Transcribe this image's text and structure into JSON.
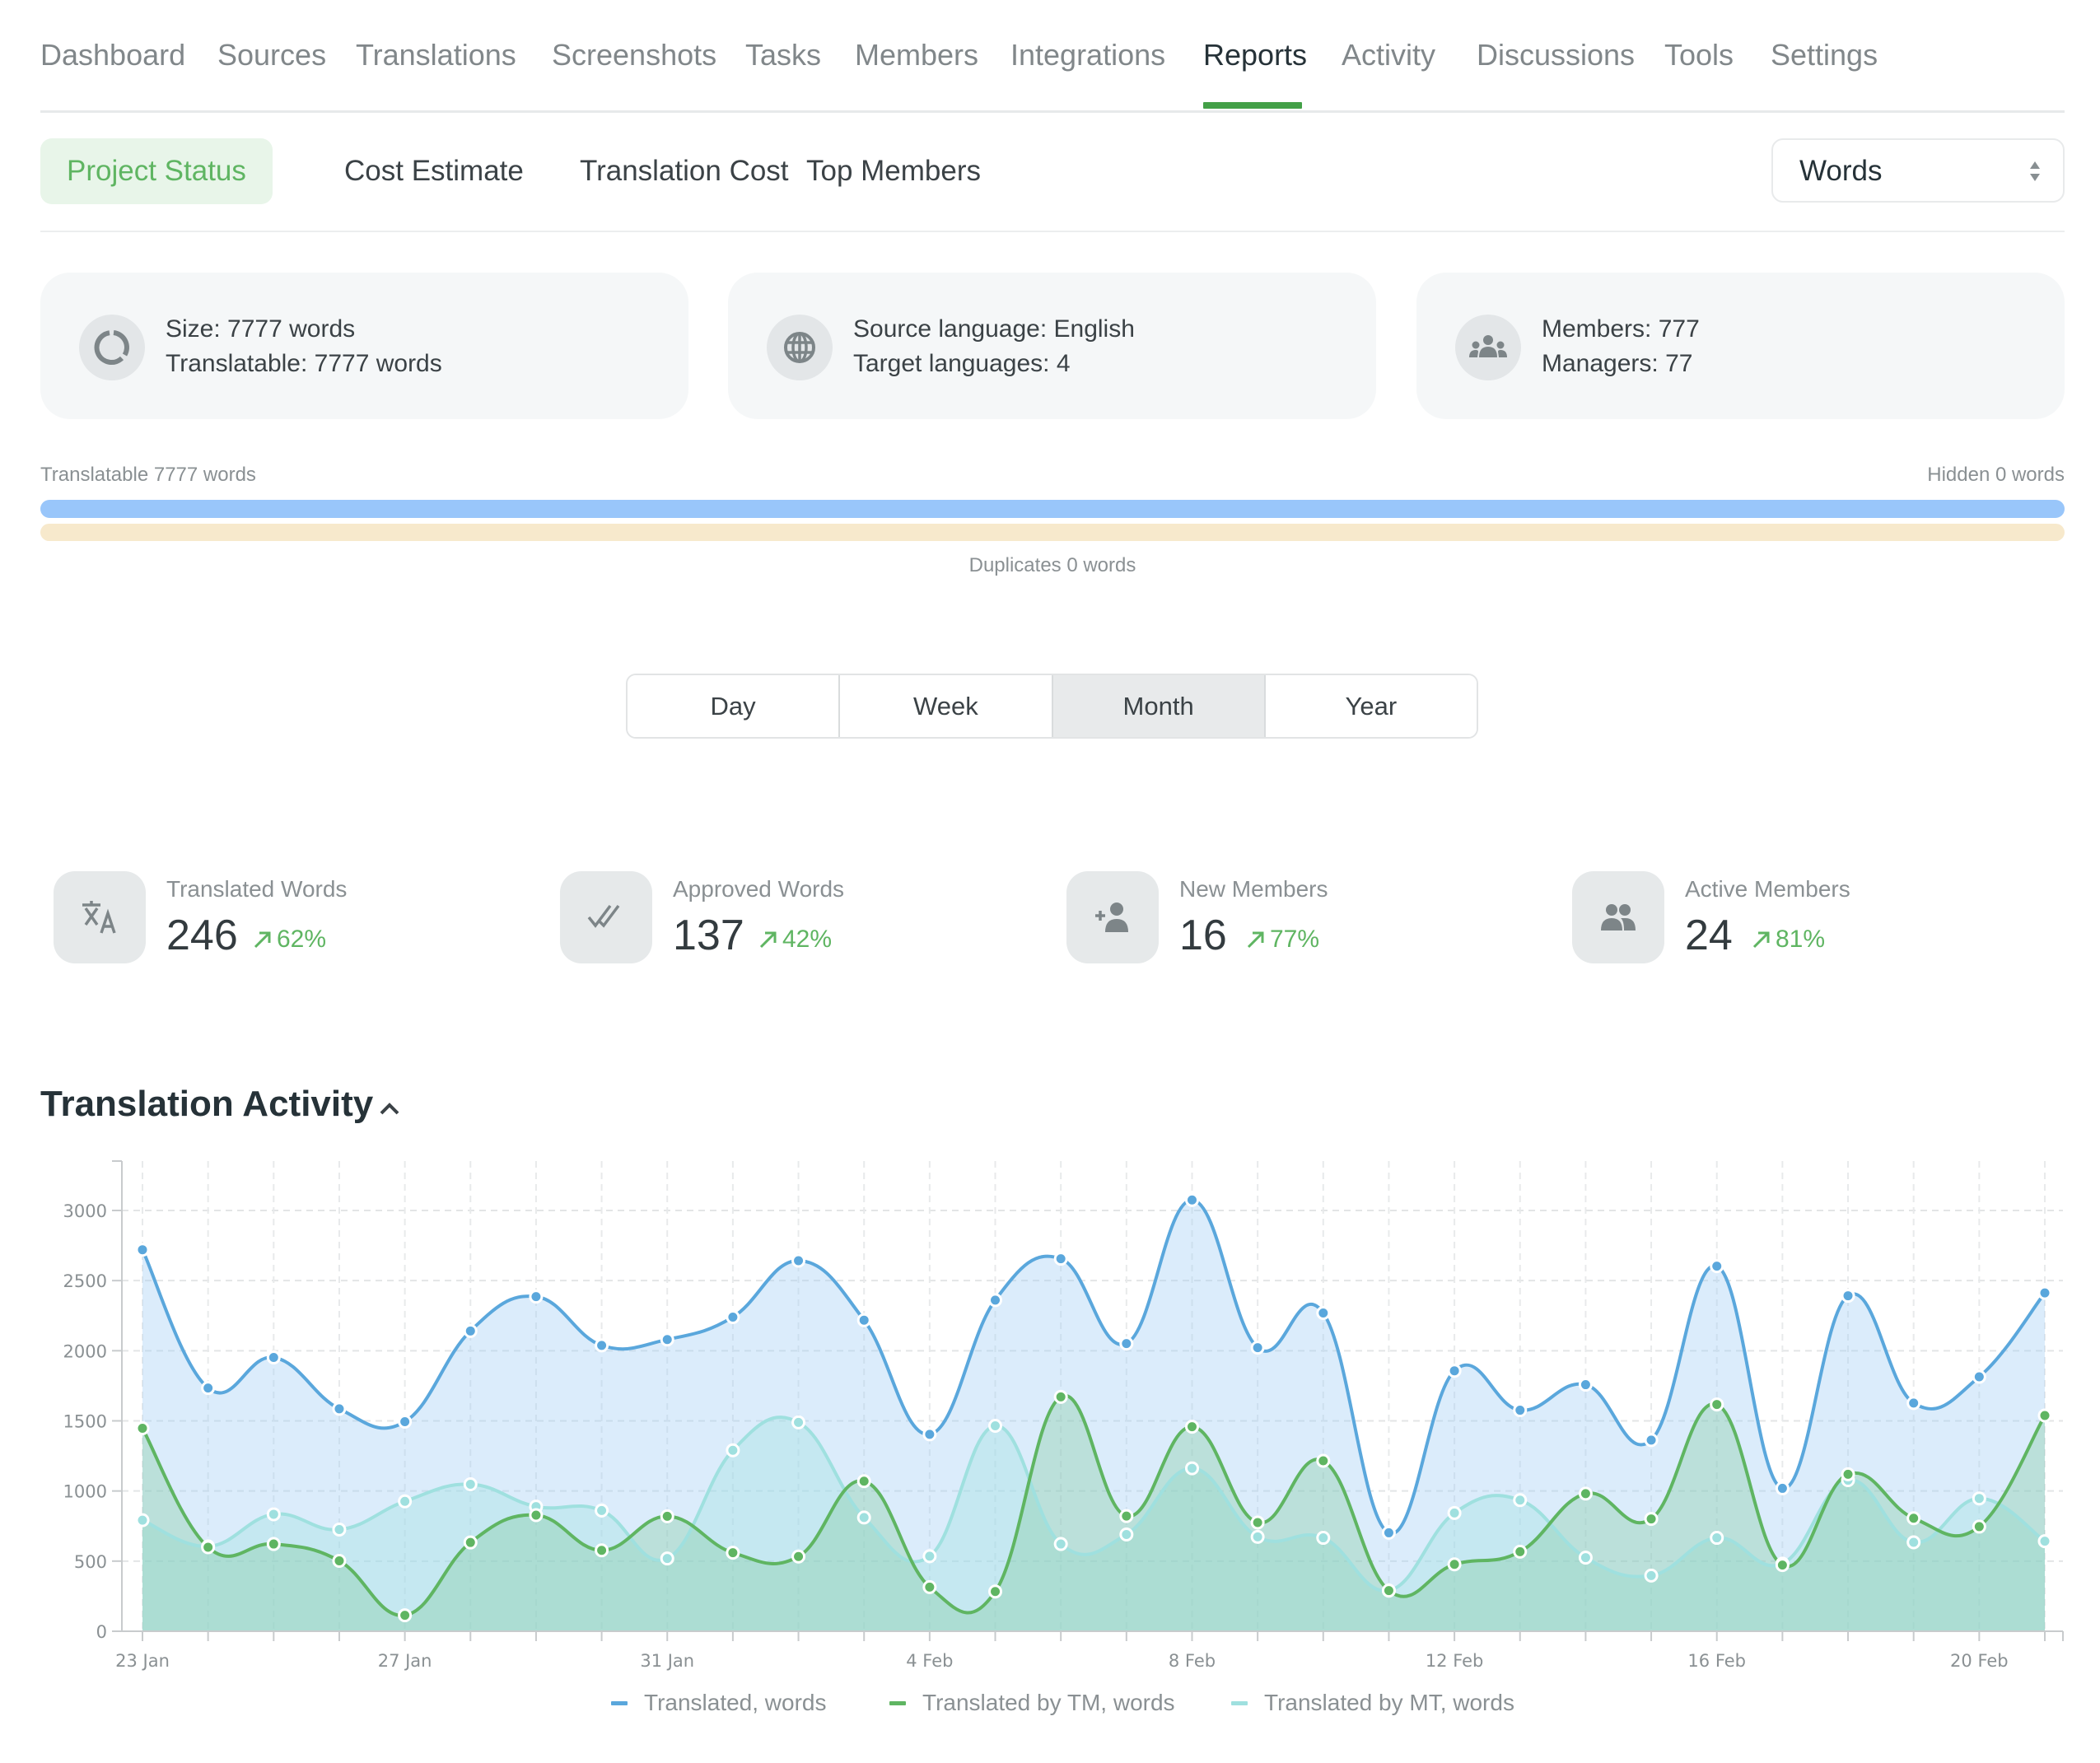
{
  "nav": {
    "tabs": [
      {
        "label": "Dashboard",
        "active": false
      },
      {
        "label": "Sources",
        "active": false
      },
      {
        "label": "Translations",
        "active": false
      },
      {
        "label": "Screenshots",
        "active": false
      },
      {
        "label": "Tasks",
        "active": false
      },
      {
        "label": "Members",
        "active": false
      },
      {
        "label": "Integrations",
        "active": false
      },
      {
        "label": "Reports",
        "active": true
      },
      {
        "label": "Activity",
        "active": false
      },
      {
        "label": "Discussions",
        "active": false
      },
      {
        "label": "Tools",
        "active": false
      },
      {
        "label": "Settings",
        "active": false
      }
    ]
  },
  "subtabs": [
    {
      "label": "Project Status",
      "active": true
    },
    {
      "label": "Cost Estimate",
      "active": false
    },
    {
      "label": "Translation Cost",
      "active": false
    },
    {
      "label": "Top Members",
      "active": false
    }
  ],
  "unit_select": {
    "value": "Words",
    "icon": "sort-arrows-icon"
  },
  "cards": [
    {
      "icon": "progress-ring-icon",
      "line1": "Size: 7777 words",
      "line2": "Translatable: 7777 words"
    },
    {
      "icon": "globe-icon",
      "line1": "Source language: English",
      "line2": "Target languages: 4"
    },
    {
      "icon": "group-icon",
      "line1": "Members: 777",
      "line2": "Managers: 77"
    }
  ],
  "words_bar": {
    "translatable_label": "Translatable 7777 words",
    "hidden_label": "Hidden 0 words",
    "duplicates_label": "Duplicates 0 words",
    "translatable_fraction": 1.0,
    "duplicates_fraction": 1.0
  },
  "period": {
    "options": [
      "Day",
      "Week",
      "Month",
      "Year"
    ],
    "selected": "Month"
  },
  "stats": [
    {
      "icon": "translate-icon",
      "title": "Translated Words",
      "value": "246",
      "trend": "62%",
      "trend_icon": "arrow-up-right-icon"
    },
    {
      "icon": "double-check-icon",
      "title": "Approved Words",
      "value": "137",
      "trend": "42%",
      "trend_icon": "arrow-up-right-icon"
    },
    {
      "icon": "person-add-icon",
      "title": "New Members",
      "value": "16",
      "trend": "77%",
      "trend_icon": "arrow-up-right-icon"
    },
    {
      "icon": "people-icon",
      "title": "Active Members",
      "value": "24",
      "trend": "81%",
      "trend_icon": "arrow-up-right-icon"
    }
  ],
  "activity": {
    "title": "Translation Activity",
    "collapse_icon": "chevron-up-icon"
  },
  "colors": {
    "accent": "#43a047",
    "translated": "#5aa7dc",
    "tm": "#5fb562",
    "mt": "#9fe0df"
  },
  "chart_data": {
    "type": "area",
    "title": "Translation Activity",
    "xlabel": "",
    "ylabel": "",
    "x": [
      "23 Jan",
      "24 Jan",
      "25 Jan",
      "26 Jan",
      "27 Jan",
      "28 Jan",
      "29 Jan",
      "30 Jan",
      "31 Jan",
      "1 Feb",
      "2 Feb",
      "3 Feb",
      "4 Feb",
      "5 Feb",
      "6 Feb",
      "7 Feb",
      "8 Feb",
      "9 Feb",
      "10 Feb",
      "11 Feb",
      "12 Feb",
      "13 Feb",
      "14 Feb",
      "15 Feb",
      "16 Feb",
      "17 Feb",
      "18 Feb",
      "19 Feb",
      "20 Feb",
      "21 Feb"
    ],
    "x_tick_labels": [
      "23 Jan",
      "27 Jan",
      "31 Jan",
      "4 Feb",
      "8 Feb",
      "12 Feb",
      "16 Feb",
      "20 Feb"
    ],
    "ylim": [
      0,
      3300
    ],
    "y_ticks": [
      0,
      500,
      1000,
      1500,
      2000,
      2500,
      3000
    ],
    "grid": true,
    "legend_position": "bottom-center",
    "series": [
      {
        "name": "Translated, words",
        "color": "#5aa7dc",
        "values": [
          2720,
          1734,
          1952,
          1586,
          1494,
          2141,
          2386,
          2038,
          2080,
          2240,
          2642,
          2218,
          1404,
          2361,
          2656,
          2051,
          3075,
          2022,
          2269,
          702,
          1857,
          1576,
          1758,
          1363,
          2603,
          1019,
          2392,
          1627,
          1814,
          2412
        ]
      },
      {
        "name": "Translated by TM, words",
        "color": "#5fb562",
        "values": [
          1447,
          599,
          622,
          502,
          114,
          633,
          828,
          577,
          820,
          560,
          533,
          1070,
          315,
          283,
          1671,
          821,
          1458,
          775,
          1215,
          290,
          477,
          567,
          981,
          801,
          1617,
          472,
          1119,
          806,
          746,
          1538
        ]
      },
      {
        "name": "Translated by MT, words",
        "color": "#9fe0df",
        "values": [
          792,
          605,
          834,
          725,
          926,
          1048,
          889,
          861,
          519,
          1290,
          1489,
          811,
          535,
          1465,
          622,
          690,
          1162,
          673,
          666,
          290,
          843,
          935,
          525,
          397,
          666,
          482,
          1077,
          634,
          947,
          642
        ]
      }
    ]
  }
}
